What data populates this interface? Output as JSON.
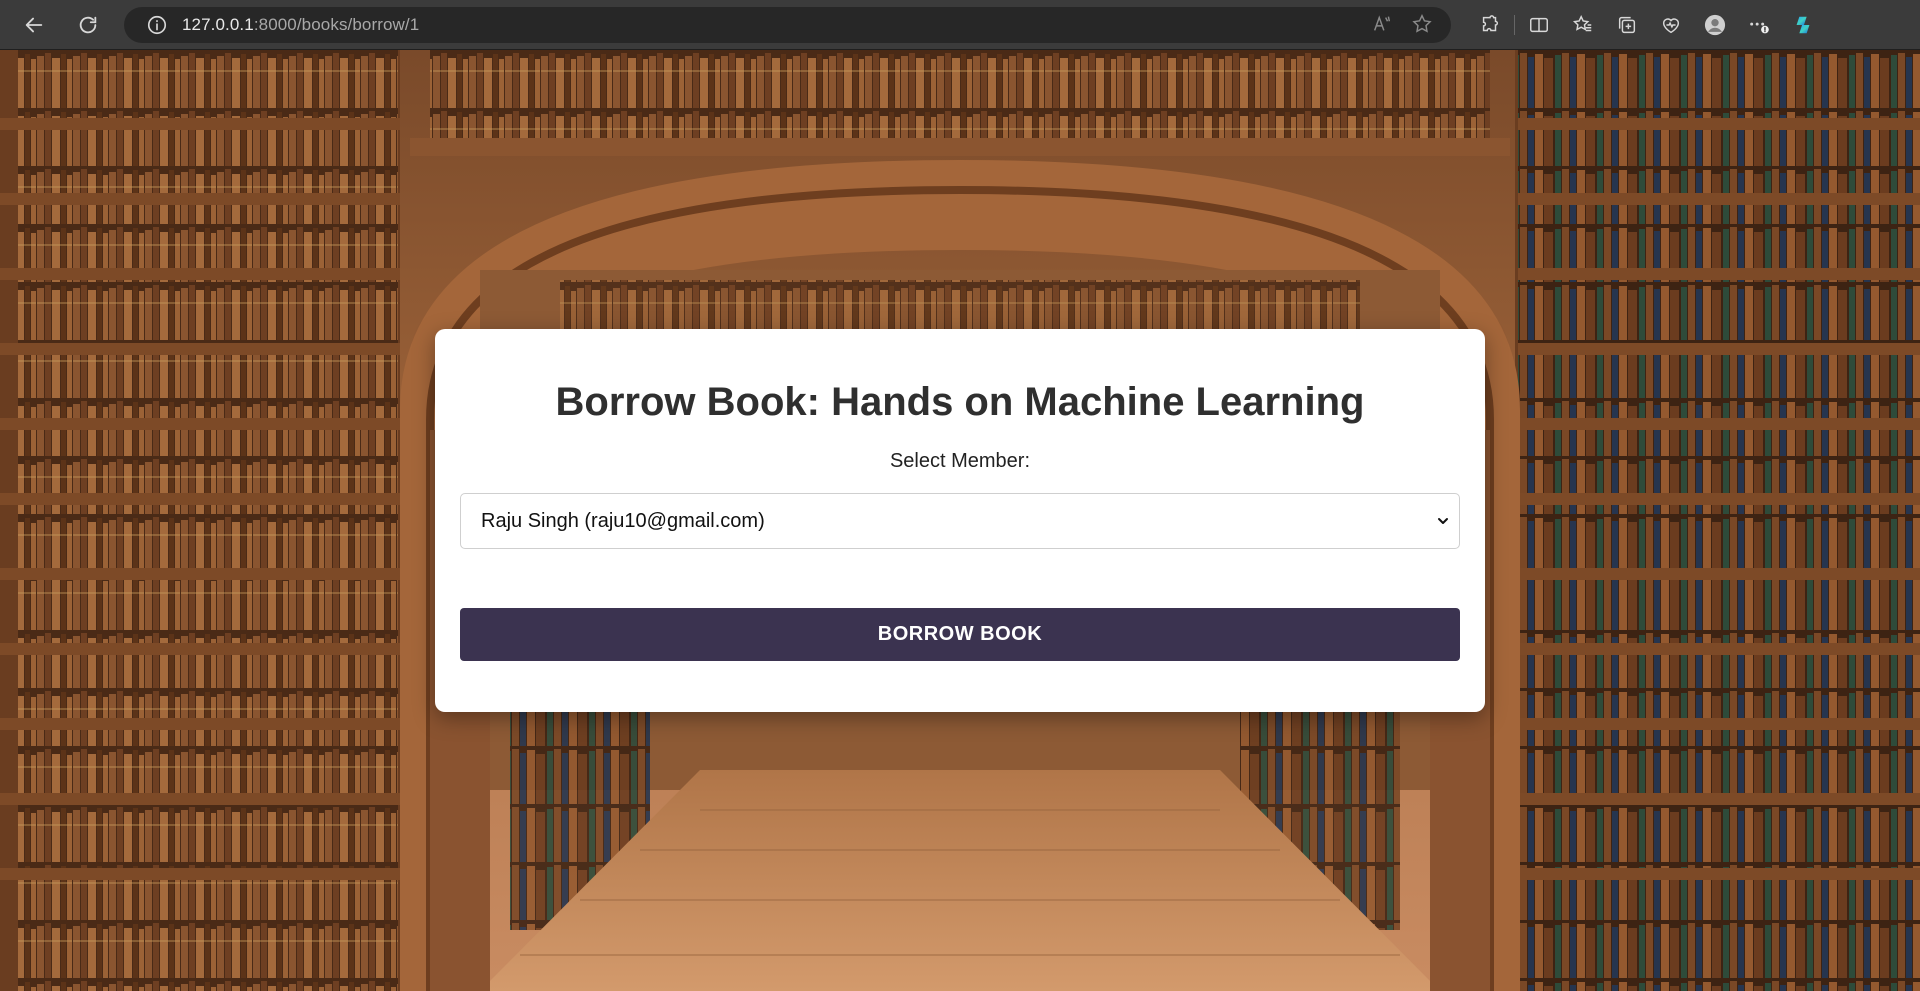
{
  "browser": {
    "url_host": "127.0.0.1",
    "url_rest": ":8000/books/borrow/1"
  },
  "page": {
    "title": "Borrow Book: Hands on Machine Learning",
    "member_label": "Select Member:",
    "selected_member": "Raju Singh (raju10@gmail.com)",
    "submit_label": "BORROW BOOK"
  },
  "colors": {
    "button": "#3b3350",
    "card": "#ffffff"
  }
}
